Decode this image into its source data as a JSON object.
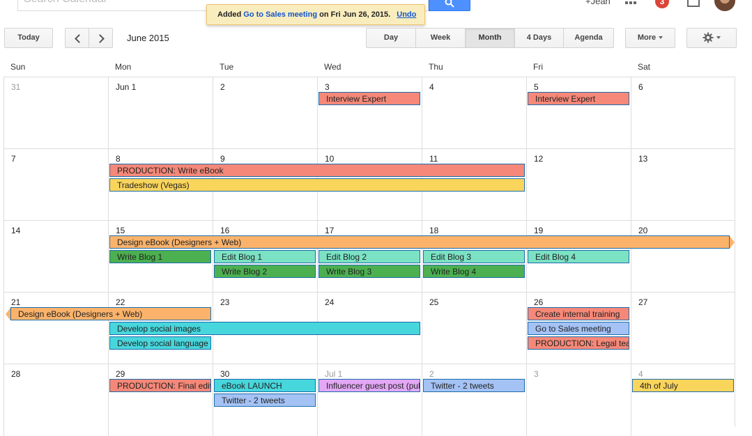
{
  "header": {
    "search_placeholder": "Search Calendar",
    "notification": {
      "prefix": "Added",
      "event_link": "Go to Sales meeting",
      "suffix": "on Fri Jun 26, 2015.",
      "undo": "Undo"
    },
    "user_name": "+Jean",
    "notification_count": "3"
  },
  "toolbar": {
    "today": "Today",
    "month_label": "June 2015",
    "views": [
      "Day",
      "Week",
      "Month",
      "4 Days",
      "Agenda"
    ],
    "active_view": "Month",
    "more": "More"
  },
  "days_of_week": [
    "Sun",
    "Mon",
    "Tue",
    "Wed",
    "Thu",
    "Fri",
    "Sat"
  ],
  "weeks": [
    {
      "days": [
        "31",
        "Jun 1",
        "2",
        "3",
        "4",
        "5",
        "6"
      ],
      "other_month": [
        true,
        false,
        false,
        false,
        false,
        false,
        false
      ],
      "events": [
        {
          "title": "Interview Expert",
          "start": 3,
          "span": 1,
          "row": 0,
          "color": "red"
        },
        {
          "title": "Interview Expert",
          "start": 5,
          "span": 1,
          "row": 0,
          "color": "red"
        }
      ]
    },
    {
      "days": [
        "7",
        "8",
        "9",
        "10",
        "11",
        "12",
        "13"
      ],
      "other_month": [
        false,
        false,
        false,
        false,
        false,
        false,
        false
      ],
      "events": [
        {
          "title": "PRODUCTION: Write eBook",
          "start": 1,
          "span": 4,
          "row": 0,
          "color": "red"
        },
        {
          "title": "Tradeshow (Vegas)",
          "start": 1,
          "span": 4,
          "row": 1,
          "color": "yellow"
        }
      ]
    },
    {
      "days": [
        "14",
        "15",
        "16",
        "17",
        "18",
        "19",
        "20"
      ],
      "other_month": [
        false,
        false,
        false,
        false,
        false,
        false,
        false
      ],
      "events": [
        {
          "title": "Design eBook (Designers + Web)",
          "start": 1,
          "span": 6,
          "row": 0,
          "color": "orange",
          "continues": "right"
        },
        {
          "title": "Write Blog 1",
          "start": 1,
          "span": 1,
          "row": 1,
          "color": "green"
        },
        {
          "title": "Edit Blog 1",
          "start": 2,
          "span": 1,
          "row": 1,
          "color": "teal"
        },
        {
          "title": "Edit Blog 2",
          "start": 3,
          "span": 1,
          "row": 1,
          "color": "teal"
        },
        {
          "title": "Edit Blog 3",
          "start": 4,
          "span": 1,
          "row": 1,
          "color": "teal"
        },
        {
          "title": "Edit Blog 4",
          "start": 5,
          "span": 1,
          "row": 1,
          "color": "teal"
        },
        {
          "title": "Write Blog 2",
          "start": 2,
          "span": 1,
          "row": 2,
          "color": "green"
        },
        {
          "title": "Write Blog 3",
          "start": 3,
          "span": 1,
          "row": 2,
          "color": "green"
        },
        {
          "title": "Write Blog 4",
          "start": 4,
          "span": 1,
          "row": 2,
          "color": "green"
        }
      ]
    },
    {
      "days": [
        "21",
        "22",
        "23",
        "24",
        "25",
        "26",
        "27"
      ],
      "other_month": [
        false,
        false,
        false,
        false,
        false,
        false,
        false
      ],
      "events": [
        {
          "title": "Design eBook (Designers + Web)",
          "start": 0,
          "span": 2,
          "row": 0,
          "color": "orange",
          "continues": "left"
        },
        {
          "title": "Create internal training",
          "start": 5,
          "span": 1,
          "row": 0,
          "color": "red"
        },
        {
          "title": "Develop social images",
          "start": 1,
          "span": 3,
          "row": 1,
          "color": "cyan"
        },
        {
          "title": "Go to Sales meeting",
          "start": 5,
          "span": 1,
          "row": 1,
          "color": "blue"
        },
        {
          "title": "Develop social language",
          "start": 1,
          "span": 1,
          "row": 2,
          "color": "cyan"
        },
        {
          "title": "PRODUCTION: Legal team review",
          "start": 5,
          "span": 1,
          "row": 2,
          "color": "red"
        }
      ]
    },
    {
      "days": [
        "28",
        "29",
        "30",
        "Jul 1",
        "2",
        "3",
        "4"
      ],
      "other_month": [
        false,
        false,
        false,
        true,
        true,
        true,
        true
      ],
      "events": [
        {
          "title": "PRODUCTION: Final edits",
          "start": 1,
          "span": 1,
          "row": 0,
          "color": "red"
        },
        {
          "title": "eBook LAUNCH",
          "start": 2,
          "span": 1,
          "row": 0,
          "color": "cyan"
        },
        {
          "title": "Influencer guest post (publish)",
          "start": 3,
          "span": 1,
          "row": 0,
          "color": "purple"
        },
        {
          "title": "Twitter - 2 tweets",
          "start": 4,
          "span": 1,
          "row": 0,
          "color": "blue"
        },
        {
          "title": "4th of July",
          "start": 6,
          "span": 1,
          "row": 0,
          "color": "yellow"
        },
        {
          "title": "Twitter - 2 tweets",
          "start": 2,
          "span": 1,
          "row": 1,
          "color": "blue"
        }
      ]
    }
  ],
  "colors": {
    "red": "#f58878",
    "yellow": "#fad55c",
    "orange": "#fbb36b",
    "green": "#4cb050",
    "teal": "#7be2c4",
    "cyan": "#47d6dc",
    "blue": "#a4c2f4",
    "purple": "#e3a7f6",
    "accent": "#4d90fe",
    "badge": "#db4437"
  }
}
